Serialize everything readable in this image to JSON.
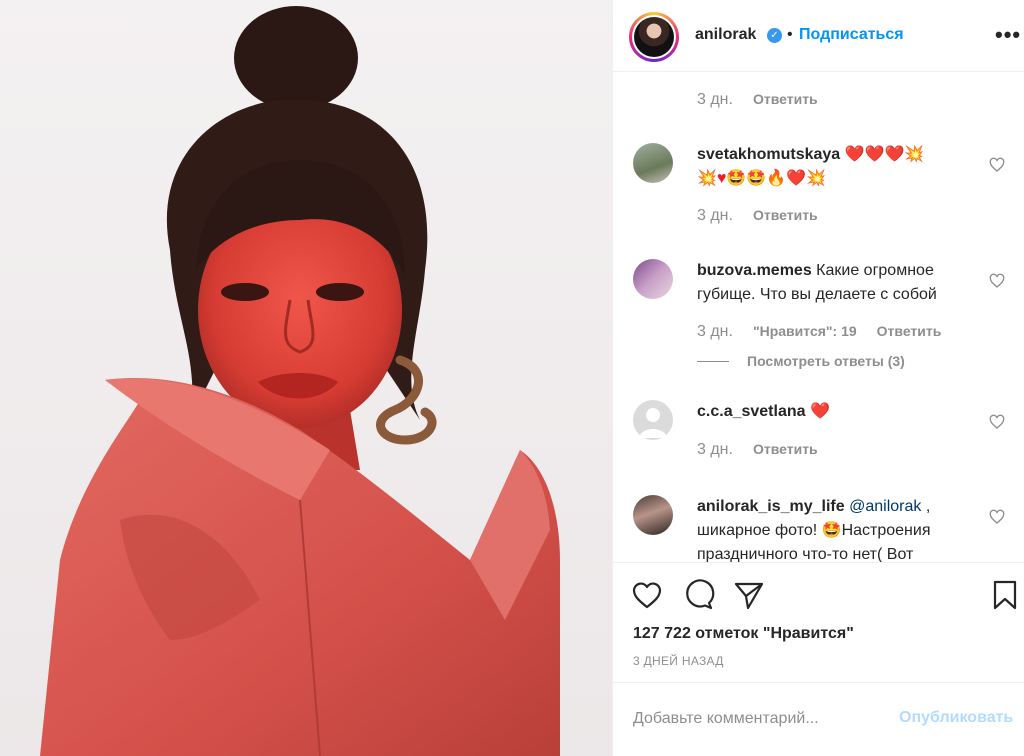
{
  "header": {
    "username": "anilorak",
    "verified_mark": "✓",
    "separator": "•",
    "follow_label": "Подписаться",
    "more_label": "•••"
  },
  "comments": [
    {
      "username": "",
      "text": "",
      "time": "3 дн.",
      "reply_label": "Ответить"
    },
    {
      "username": "svetakhomutskaya",
      "text_line1_emoji": "❤️❤️❤️💥",
      "text_line2_emoji": "💥♥🤩🤩🔥❤️💥",
      "time": "3 дн.",
      "reply_label": "Ответить"
    },
    {
      "username": "buzova.memes",
      "text": "Какие огромное губище. Что вы делаете с собой",
      "time": "3 дн.",
      "likes_label": "\"Нравится\": 19",
      "reply_label": "Ответить",
      "view_replies": "Посмотреть ответы (3)"
    },
    {
      "username": "c.c.a_svetlana",
      "text": "❤️",
      "time": "3 дн.",
      "reply_label": "Ответить"
    },
    {
      "username": "anilorak_is_my_life",
      "mention": "@anilorak",
      "text_after_mention": " , шикарное фото! 🤩Настроения праздничного что-то нет( Вот"
    }
  ],
  "actions": {
    "likes_text": "127 722 отметок \"Нравится\"",
    "date": "3 ДНЕЙ НАЗАД",
    "icons": [
      "heart-icon",
      "comment-icon",
      "share-icon",
      "bookmark-icon"
    ]
  },
  "add_comment": {
    "placeholder": "Добавьте комментарий...",
    "publish_label": "Опубликовать"
  },
  "colors": {
    "accent": "#0095f6",
    "publish_disabled": "#b3dbff",
    "muted": "#8e8e8e",
    "text": "#262626",
    "photo_red": "#d9463f"
  }
}
